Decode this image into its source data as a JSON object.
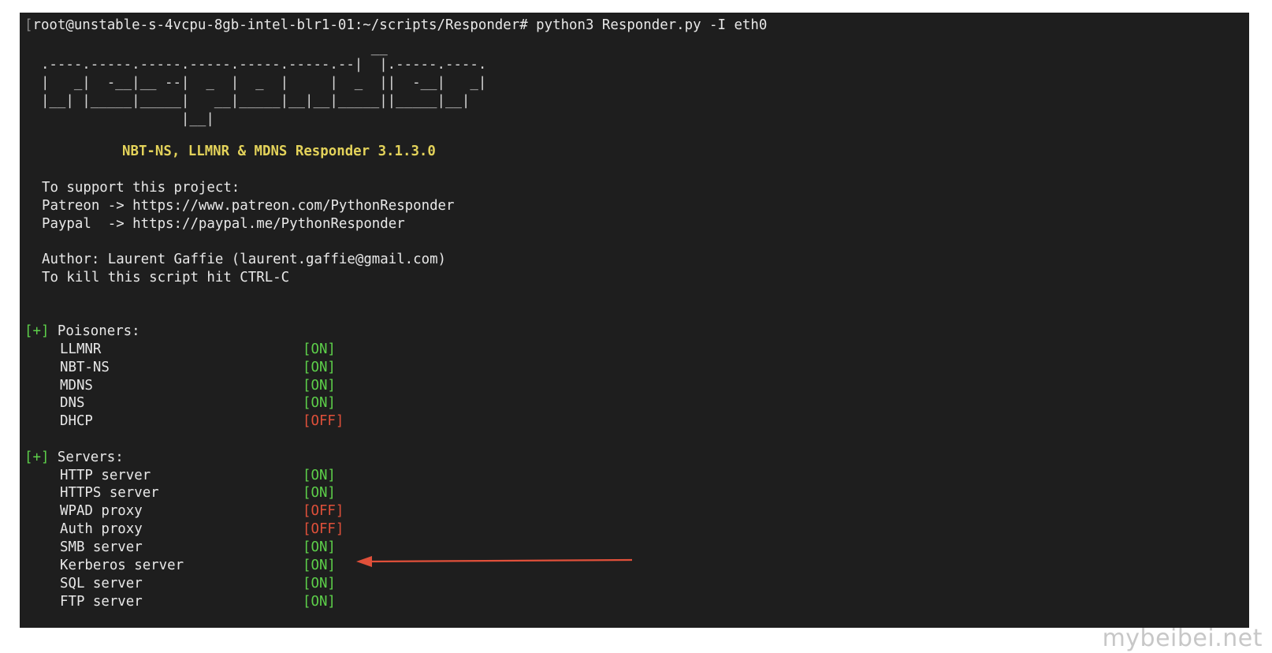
{
  "terminal": {
    "prompt_line": "root@unstable-s-4vcpu-8gb-intel-blr1-01:~/scripts/Responder# python3 Responder.py -I eth0",
    "banner": [
      "                                          __",
      "  .----.-----.-----.-----.-----.-----.--|  |.-----.----.",
      "  |   _|  -__|__ --|  _  |  _  |     |  _  ||  -__|   _|",
      "  |__| |_____|_____|   __|_____|__|__|_____||_____|__|",
      "                   |__|"
    ],
    "title": "NBT-NS, LLMNR & MDNS Responder 3.1.3.0",
    "support_header": "To support this project:",
    "patreon": "Patreon -> https://www.patreon.com/PythonResponder",
    "paypal": "Paypal  -> https://paypal.me/PythonResponder",
    "author": "Author: Laurent Gaffie (laurent.gaffie@gmail.com)",
    "kill_hint": "To kill this script hit CTRL-C",
    "bullet": "[+]",
    "poisoners_label": "Poisoners:",
    "poisoners": [
      {
        "name": "LLMNR",
        "status": "[ON]"
      },
      {
        "name": "NBT-NS",
        "status": "[ON]"
      },
      {
        "name": "MDNS",
        "status": "[ON]"
      },
      {
        "name": "DNS",
        "status": "[ON]"
      },
      {
        "name": "DHCP",
        "status": "[OFF]"
      }
    ],
    "servers_label": "Servers:",
    "servers": [
      {
        "name": "HTTP server",
        "status": "[ON]"
      },
      {
        "name": "HTTPS server",
        "status": "[ON]"
      },
      {
        "name": "WPAD proxy",
        "status": "[OFF]"
      },
      {
        "name": "Auth proxy",
        "status": "[OFF]"
      },
      {
        "name": "SMB server",
        "status": "[ON]"
      },
      {
        "name": "Kerberos server",
        "status": "[ON]"
      },
      {
        "name": "SQL server",
        "status": "[ON]"
      },
      {
        "name": "FTP server",
        "status": "[ON]"
      }
    ]
  },
  "colors": {
    "background": "#1e1e1e",
    "on": "#5dd04a",
    "off": "#e0503a",
    "title": "#e3d25a",
    "annotation_arrow": "#e0503a"
  },
  "watermark": "mybeibei.net"
}
